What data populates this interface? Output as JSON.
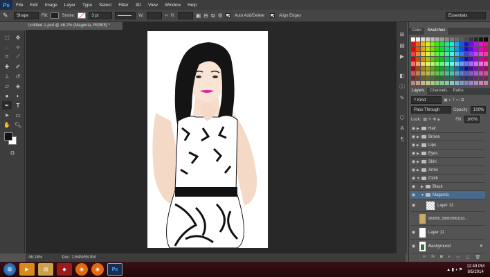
{
  "app": {
    "logo": "Ps"
  },
  "menu": [
    "File",
    "Edit",
    "Image",
    "Layer",
    "Type",
    "Select",
    "Filter",
    "3D",
    "View",
    "Window",
    "Help"
  ],
  "options": {
    "mode": "Shape",
    "fill_label": "Fill:",
    "stroke_label": "Stroke:",
    "stroke_width": "3 pt",
    "w_label": "W:",
    "h_label": "H:",
    "auto_add_delete": "Auto Add/Delete",
    "align_edges": "Align Edges",
    "workspace": "Essentials"
  },
  "document": {
    "tab_title": "Untitled-1.psd @ 46.2% (Magenta, RGB/8) *",
    "zoom": "46.18%",
    "doc_info": "Doc: 2.64M/58.9M"
  },
  "color_panel": {
    "tabs": [
      "Color",
      "Swatches"
    ],
    "active": "Swatches"
  },
  "layers_panel": {
    "tabs": [
      "Layers",
      "Channels",
      "Paths"
    ],
    "kind_label": "Kind",
    "blend_mode": "Pass Through",
    "opacity_label": "Opacity:",
    "opacity": "100%",
    "lock_label": "Lock:",
    "fill_label": "Fill:",
    "fill": "100%",
    "layers": [
      {
        "name": "Hair",
        "type": "group"
      },
      {
        "name": "Brows",
        "type": "group"
      },
      {
        "name": "Lips",
        "type": "group"
      },
      {
        "name": "Eyes",
        "type": "group"
      },
      {
        "name": "Skin",
        "type": "group"
      },
      {
        "name": "Arms",
        "type": "group"
      },
      {
        "name": "Cloth",
        "type": "group-open"
      },
      {
        "name": "Black",
        "type": "subgroup"
      },
      {
        "name": "Magenta",
        "type": "subgroup-open"
      },
      {
        "name": "Layer 12",
        "type": "layer"
      },
      {
        "name": "963055_589015661163...",
        "type": "image"
      },
      {
        "name": "Layer 11",
        "type": "layer"
      },
      {
        "name": "Background",
        "type": "background"
      }
    ]
  },
  "taskbar": {
    "time": "12:49 PM",
    "date": "8/5/2014"
  },
  "colors": {
    "accent": "#2d6da3",
    "ps_blue": "#4fa8ff",
    "bg": "#535353"
  },
  "icons": [
    "pen-tool-icon",
    "move-icon",
    "marquee-icon",
    "lasso-icon",
    "crop-icon",
    "eyedropper-icon",
    "brush-icon",
    "eraser-icon",
    "type-icon",
    "hand-icon",
    "zoom-icon",
    "eye-icon",
    "folder-icon"
  ]
}
